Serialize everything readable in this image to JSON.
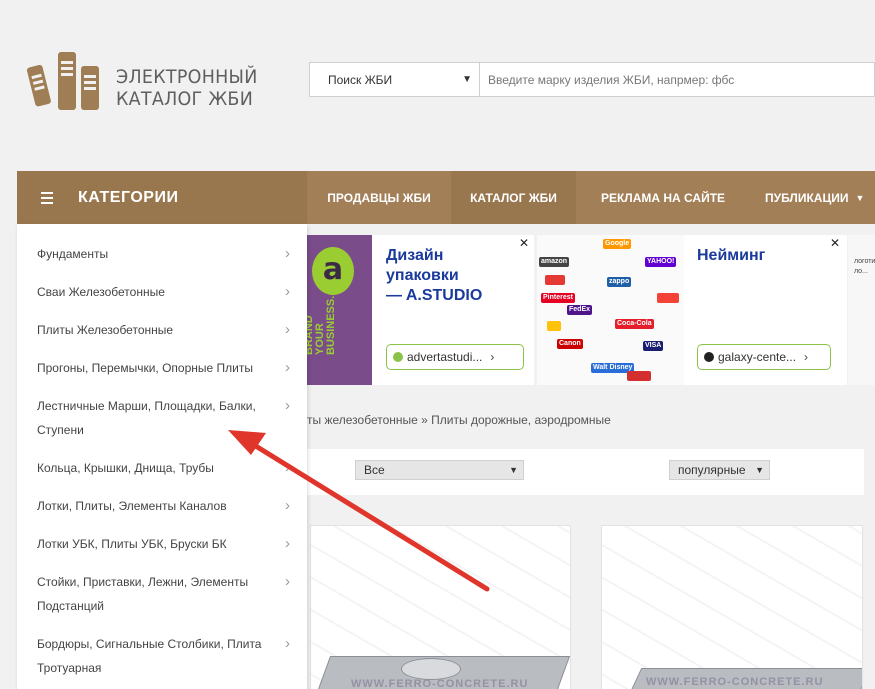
{
  "logo": {
    "line1": "ЭЛЕКТРОННЫЙ",
    "line2": "КАТАЛОГ ЖБИ"
  },
  "search": {
    "select_value": "Поиск ЖБИ",
    "placeholder": "Введите марку изделия ЖБИ, напрмер: фбс"
  },
  "nav": {
    "categories_label": "КАТЕГОРИИ",
    "items": [
      "ПРОДАВЦЫ ЖБИ",
      "КАТАЛОГ ЖБИ",
      "РЕКЛАМА НА САЙТЕ",
      "ПУБЛИКАЦИИ"
    ],
    "active_index": 1
  },
  "categories": [
    {
      "line1": "Фундаменты",
      "line2": ""
    },
    {
      "line1": "Сваи Железобетонные",
      "line2": ""
    },
    {
      "line1": "Плиты Железобетонные",
      "line2": ""
    },
    {
      "line1": "Прогоны, Перемычки, Опорные Плиты",
      "line2": ""
    },
    {
      "line1": "Лестничные Марши, Площадки, Балки,",
      "line2": "Ступени"
    },
    {
      "line1": "Кольца, Крышки, Днища, Трубы",
      "line2": ""
    },
    {
      "line1": "Лотки, Плиты, Элементы Каналов",
      "line2": ""
    },
    {
      "line1": "Лотки УБК, Плиты УБК, Бруски БК",
      "line2": ""
    },
    {
      "line1": "Стойки, Приставки, Лежни, Элементы",
      "line2": "Подстанций"
    },
    {
      "line1": "Бордюры, Сигнальные Столбики, Плита",
      "line2": "Тротуарная"
    }
  ],
  "ads": [
    {
      "title_line1": "Дизайн",
      "title_line2": "упаковки",
      "title_line3": "— A.STUDIO",
      "link": "advertastudi...",
      "image_letter": "a",
      "image_text": [
        "BRAND",
        "YOUR",
        "BUSINESS."
      ]
    },
    {
      "title_line1": "Нейминг",
      "link": "galaxy-cente...",
      "brand_logos": [
        "amazon",
        "Google",
        "Pinterest",
        "FedEx",
        "Coca-Cola",
        "Canon",
        "VISA",
        "YAHOO!",
        "zappo",
        "Walt Disney"
      ]
    },
    {
      "text": [
        "логотип",
        "ло..."
      ]
    }
  ],
  "breadcrumb": "ты железобетонные » Плиты дорожные, аэродромные",
  "filters": {
    "type_value": "Все",
    "sort_value": "популярные"
  },
  "watermark": "WWW.FERRO-CONCRETE.RU",
  "colors": {
    "brand": "#a27f57",
    "brand_dark": "#98774f",
    "annotation_arrow": "#e0352b"
  }
}
